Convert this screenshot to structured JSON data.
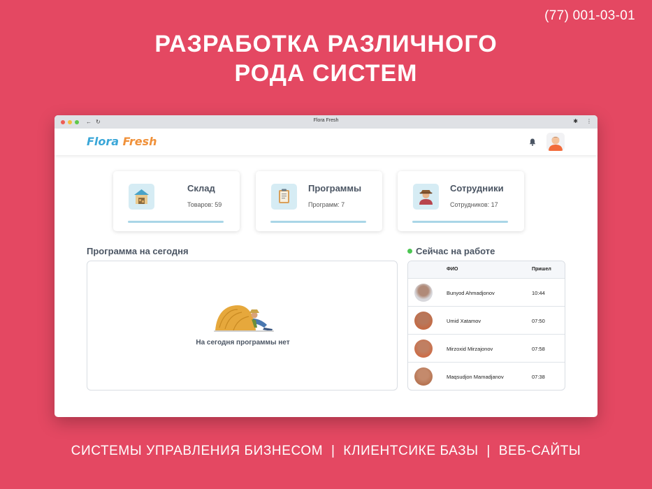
{
  "phone": "(77) 001-03-01",
  "headline": {
    "line1": "РАЗРАБОТКА РАЗЛИЧНОГО",
    "line2": "РОДА СИСТЕМ"
  },
  "browser": {
    "tab_title": "Flora Fresh"
  },
  "app": {
    "logo_part1": "Flora",
    "logo_part2": "Fresh",
    "bell_icon": "bell-icon",
    "avatar_icon": "user-avatar-icon"
  },
  "cards": [
    {
      "title": "Склад",
      "subtitle": "Товаров: 59",
      "icon": "warehouse-icon"
    },
    {
      "title": "Программы",
      "subtitle": "Программ: 7",
      "icon": "clipboard-icon"
    },
    {
      "title": "Сотрудники",
      "subtitle": "Сотрудников: 17",
      "icon": "employee-icon"
    }
  ],
  "program_today": {
    "title": "Программа на сегодня",
    "empty_text": "На сегодня программы нет",
    "illustration": "resting-farmer-illustration"
  },
  "at_work": {
    "title": "Сейчас на работе",
    "col_name": "ФИО",
    "col_time": "Пришел",
    "rows": [
      {
        "name": "Bunyod Ahmadjonov",
        "time": "10:44"
      },
      {
        "name": "Umid Xatamov",
        "time": "07:50"
      },
      {
        "name": "Mirzoxid Mirzajonov",
        "time": "07:58"
      },
      {
        "name": "Maqsudjon Mamadjanov",
        "time": "07:38"
      }
    ]
  },
  "footer": {
    "text": "СИСТЕМЫ УПРАВЛЕНИЯ БИЗНЕСОМ  |  КЛИЕНТСИКЕ БАЗЫ  |  ВЕБ-САЙТЫ"
  },
  "colors": {
    "background": "#e44862",
    "logo_blue": "#3ba7d8",
    "logo_orange": "#f0913a",
    "status_green": "#4cc653",
    "card_bar": "#a9d6e7"
  }
}
